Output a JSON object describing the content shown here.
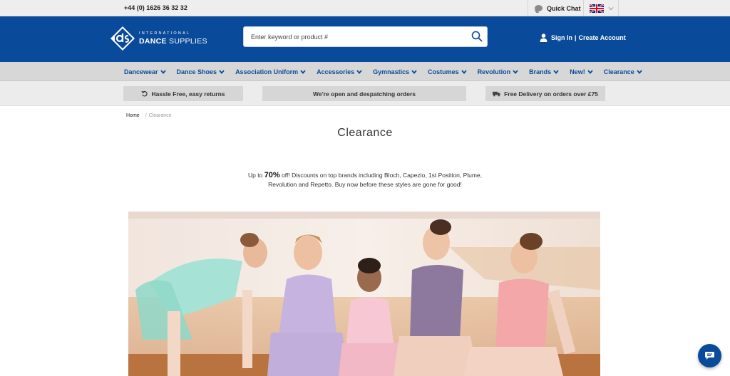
{
  "topbar": {
    "phone": "+44 (0) 1626 36 32 32",
    "quick_chat": "Quick Chat",
    "language_flag": "uk-flag-icon"
  },
  "header": {
    "logo_line1": "INTERNATIONAL",
    "logo_line2_bold": "DANCE",
    "logo_line2_rest": " SUPPLIES",
    "search_placeholder": "Enter keyword or product #",
    "sign_in": "Sign In",
    "separator": "|",
    "create_account": "Create Account"
  },
  "nav": {
    "items": [
      {
        "label": "Dancewear"
      },
      {
        "label": "Dance Shoes"
      },
      {
        "label": "Association Uniform"
      },
      {
        "label": "Accessories"
      },
      {
        "label": "Gymnastics"
      },
      {
        "label": "Costumes"
      },
      {
        "label": "Revolution"
      },
      {
        "label": "Brands"
      },
      {
        "label": "New!"
      },
      {
        "label": "Clearance"
      }
    ]
  },
  "promos": {
    "returns": "Hassle Free, easy returns",
    "open": "We're open and despatching orders",
    "delivery": "Free Delivery on orders over £75"
  },
  "breadcrumb": {
    "home": "Home",
    "slash": "/",
    "current": "Clearance"
  },
  "page": {
    "title": "Clearance",
    "intro_prefix": "Up to ",
    "intro_highlight": "70%",
    "intro_line1_rest": " off! Discounts on top brands including Bloch, Capezio, 1st Position, Plume,",
    "intro_line2": "Revolution and Repetto. Buy now before these styles are gone for good!"
  },
  "colors": {
    "brand_blue": "#0a4a9b",
    "nav_bg": "#d7d7d7",
    "promo_bg": "#d6d6d6"
  }
}
